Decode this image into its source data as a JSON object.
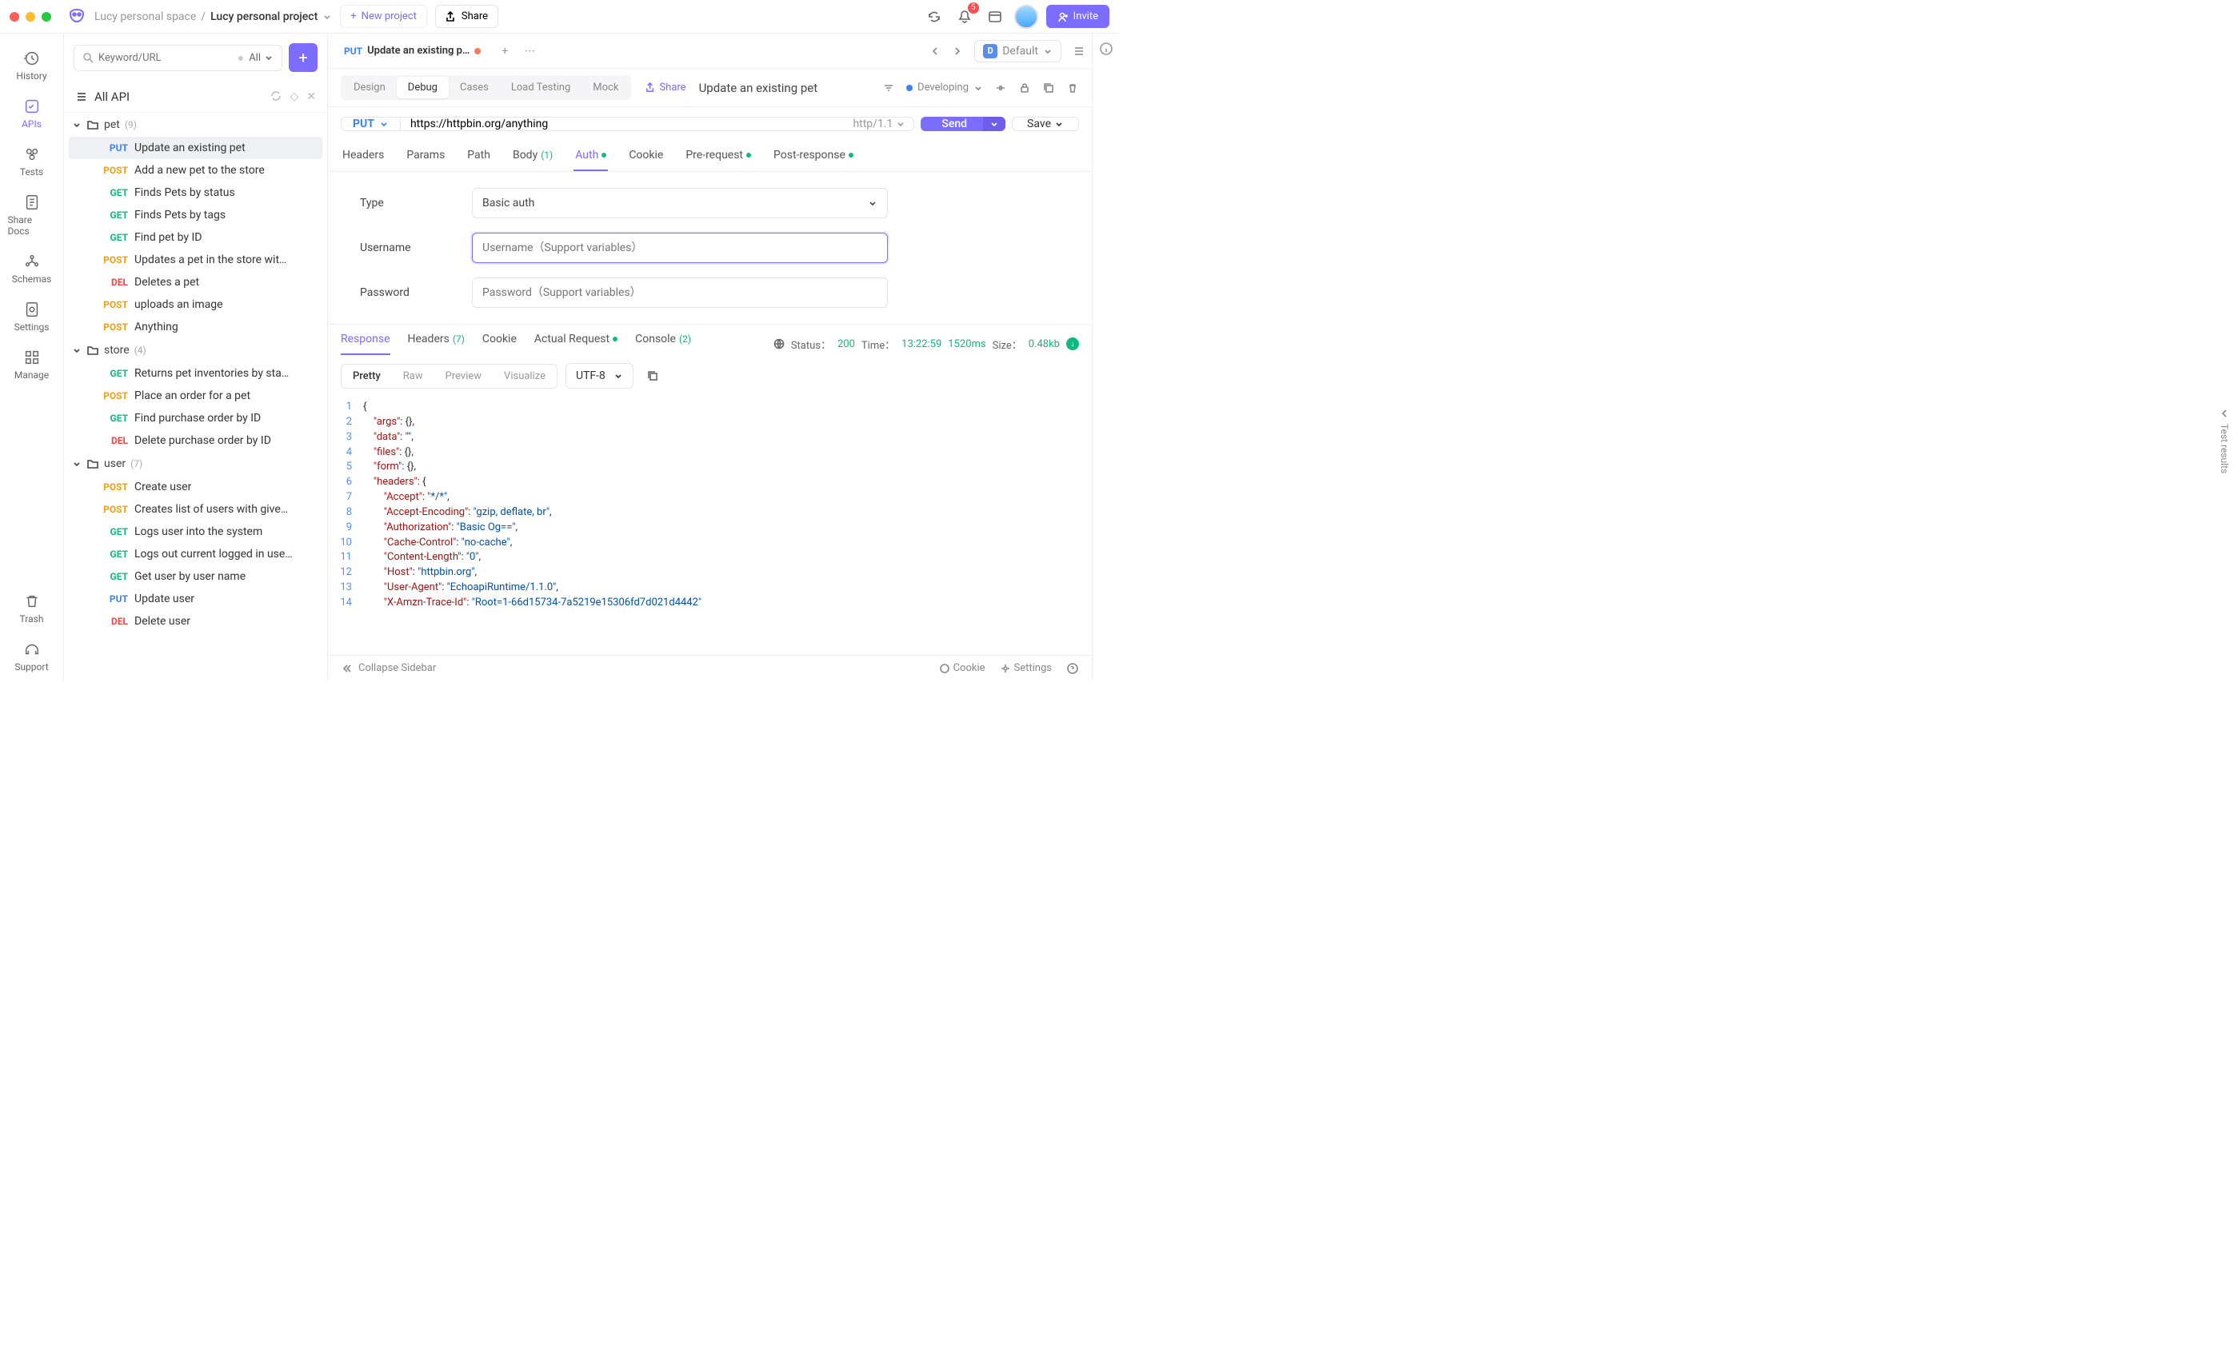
{
  "titlebar": {
    "workspace": "Lucy personal space",
    "project": "Lucy personal project",
    "new_project": "New project",
    "share": "Share",
    "notifications": "5",
    "invite": "Invite"
  },
  "rail": {
    "history": "History",
    "apis": "APIs",
    "tests": "Tests",
    "share_docs": "Share Docs",
    "schemas": "Schemas",
    "settings": "Settings",
    "manage": "Manage",
    "trash": "Trash",
    "support": "Support"
  },
  "sidebar": {
    "search_placeholder": "Keyword/URL",
    "filter": "All",
    "all_api": "All API",
    "folders": [
      {
        "name": "pet",
        "count": "(9)",
        "items": [
          {
            "method": "PUT",
            "name": "Update an existing pet",
            "selected": true
          },
          {
            "method": "POST",
            "name": "Add a new pet to the store"
          },
          {
            "method": "GET",
            "name": "Finds Pets by status"
          },
          {
            "method": "GET",
            "name": "Finds Pets by tags"
          },
          {
            "method": "GET",
            "name": "Find pet by ID"
          },
          {
            "method": "POST",
            "name": "Updates a pet in the store wit…"
          },
          {
            "method": "DEL",
            "name": "Deletes a pet"
          },
          {
            "method": "POST",
            "name": "uploads an image"
          },
          {
            "method": "POST",
            "name": "Anything"
          }
        ]
      },
      {
        "name": "store",
        "count": "(4)",
        "items": [
          {
            "method": "GET",
            "name": "Returns pet inventories by sta…"
          },
          {
            "method": "POST",
            "name": "Place an order for a pet"
          },
          {
            "method": "GET",
            "name": "Find purchase order by ID"
          },
          {
            "method": "DEL",
            "name": "Delete purchase order by ID"
          }
        ]
      },
      {
        "name": "user",
        "count": "(7)",
        "items": [
          {
            "method": "POST",
            "name": "Create user"
          },
          {
            "method": "POST",
            "name": "Creates list of users with give…"
          },
          {
            "method": "GET",
            "name": "Logs user into the system"
          },
          {
            "method": "GET",
            "name": "Logs out current logged in use…"
          },
          {
            "method": "GET",
            "name": "Get user by user name"
          },
          {
            "method": "PUT",
            "name": "Update user"
          },
          {
            "method": "DEL",
            "name": "Delete user"
          }
        ]
      }
    ]
  },
  "tab": {
    "method": "PUT",
    "title": "Update an existing p…"
  },
  "env": {
    "badge": "D",
    "name": "Default"
  },
  "modes": {
    "design": "Design",
    "debug": "Debug",
    "cases": "Cases",
    "load": "Load Testing",
    "mock": "Mock",
    "share": "Share",
    "op_name": "Update an existing pet",
    "status": "Developing"
  },
  "request": {
    "method": "PUT",
    "url": "https://httpbin.org/anything",
    "proto": "http/1.1",
    "send": "Send",
    "save": "Save",
    "tabs": {
      "headers": "Headers",
      "params": "Params",
      "path": "Path",
      "body": "Body",
      "body_count": "(1)",
      "auth": "Auth",
      "cookie": "Cookie",
      "pre": "Pre-request",
      "post": "Post-response"
    },
    "auth": {
      "type_label": "Type",
      "type_value": "Basic auth",
      "username_label": "Username",
      "username_placeholder": "Username（Support variables）",
      "password_label": "Password",
      "password_placeholder": "Password（Support variables）"
    }
  },
  "response": {
    "tabs": {
      "response": "Response",
      "headers": "Headers",
      "headers_count": "(7)",
      "cookie": "Cookie",
      "actual": "Actual Request",
      "console": "Console",
      "console_count": "(2)"
    },
    "meta": {
      "status_label": "Status：",
      "status_code": "200",
      "time_label": "Time：",
      "time_at": "13:22:59",
      "duration": "1520ms",
      "size_label": "Size：",
      "size": "0.48kb"
    },
    "views": {
      "pretty": "Pretty",
      "raw": "Raw",
      "preview": "Preview",
      "visualize": "Visualize"
    },
    "encoding": "UTF-8",
    "body_lines": [
      {
        "n": "1",
        "html": "<span class='p'>{</span>"
      },
      {
        "n": "2",
        "html": "    <span class='k'>\"args\"</span><span class='p'>: {},</span>"
      },
      {
        "n": "3",
        "html": "    <span class='k'>\"data\"</span><span class='p'>: </span><span class='s'>\"\"</span><span class='p'>,</span>"
      },
      {
        "n": "4",
        "html": "    <span class='k'>\"files\"</span><span class='p'>: {},</span>"
      },
      {
        "n": "5",
        "html": "    <span class='k'>\"form\"</span><span class='p'>: {},</span>"
      },
      {
        "n": "6",
        "html": "    <span class='k'>\"headers\"</span><span class='p'>: {</span>"
      },
      {
        "n": "7",
        "html": "        <span class='k'>\"Accept\"</span><span class='p'>: </span><span class='s'>\"*/*\"</span><span class='p'>,</span>"
      },
      {
        "n": "8",
        "html": "        <span class='k'>\"Accept-Encoding\"</span><span class='p'>: </span><span class='s'>\"gzip, deflate, br\"</span><span class='p'>,</span>"
      },
      {
        "n": "9",
        "html": "        <span class='k'>\"Authorization\"</span><span class='p'>: </span><span class='s'>\"Basic Og==\"</span><span class='p'>,</span>"
      },
      {
        "n": "10",
        "html": "        <span class='k'>\"Cache-Control\"</span><span class='p'>: </span><span class='s'>\"no-cache\"</span><span class='p'>,</span>"
      },
      {
        "n": "11",
        "html": "        <span class='k'>\"Content-Length\"</span><span class='p'>: </span><span class='s'>\"0\"</span><span class='p'>,</span>"
      },
      {
        "n": "12",
        "html": "        <span class='k'>\"Host\"</span><span class='p'>: </span><span class='s'>\"httpbin.org\"</span><span class='p'>,</span>"
      },
      {
        "n": "13",
        "html": "        <span class='k'>\"User-Agent\"</span><span class='p'>: </span><span class='s'>\"EchoapiRuntime/1.1.0\"</span><span class='p'>,</span>"
      },
      {
        "n": "14",
        "html": "        <span class='k'>\"X-Amzn-Trace-Id\"</span><span class='p'>: </span><span class='s'>\"Root=1-66d15734-7a5219e15306fd7d021d4442\"</span>"
      }
    ]
  },
  "test_results_label": "Test results",
  "footer": {
    "collapse": "Collapse Sidebar",
    "cookie": "Cookie",
    "settings": "Settings"
  }
}
